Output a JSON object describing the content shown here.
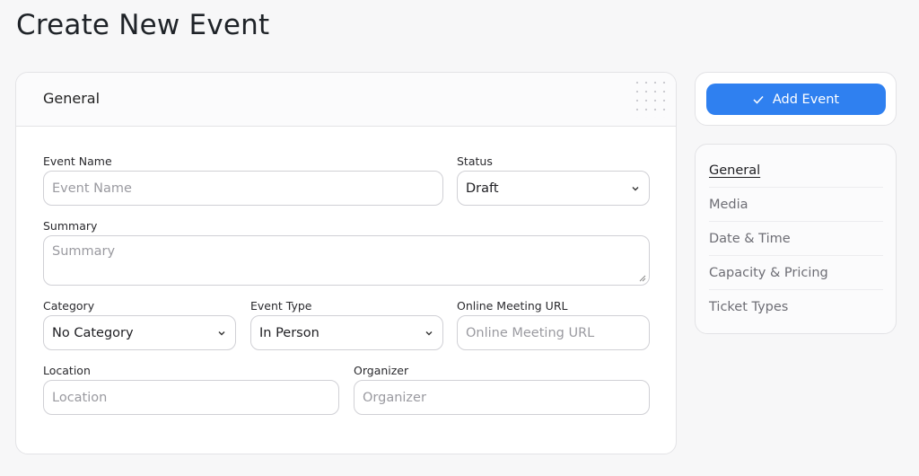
{
  "page": {
    "title": "Create New Event"
  },
  "card": {
    "title": "General"
  },
  "fields": {
    "event_name": {
      "label": "Event Name",
      "placeholder": "Event Name"
    },
    "status": {
      "label": "Status",
      "value": "Draft"
    },
    "summary": {
      "label": "Summary",
      "placeholder": "Summary"
    },
    "category": {
      "label": "Category",
      "value": "No Category"
    },
    "event_type": {
      "label": "Event Type",
      "value": "In Person"
    },
    "online_url": {
      "label": "Online Meeting URL",
      "placeholder": "Online Meeting URL"
    },
    "location": {
      "label": "Location",
      "placeholder": "Location"
    },
    "organizer": {
      "label": "Organizer",
      "placeholder": "Organizer"
    }
  },
  "actions": {
    "add_event_label": "Add Event"
  },
  "nav": {
    "items": [
      {
        "label": "General",
        "active": true
      },
      {
        "label": "Media",
        "active": false
      },
      {
        "label": "Date & Time",
        "active": false
      },
      {
        "label": "Capacity & Pricing",
        "active": false
      },
      {
        "label": "Ticket Types",
        "active": false
      }
    ]
  },
  "colors": {
    "accent": "#2f80f0",
    "background": "#f7f7f8",
    "border": "#e3e3e6"
  },
  "icons": {
    "add_button": "check-icon",
    "select": "chevron-down-icon",
    "textarea": "resize-handle-icon"
  }
}
